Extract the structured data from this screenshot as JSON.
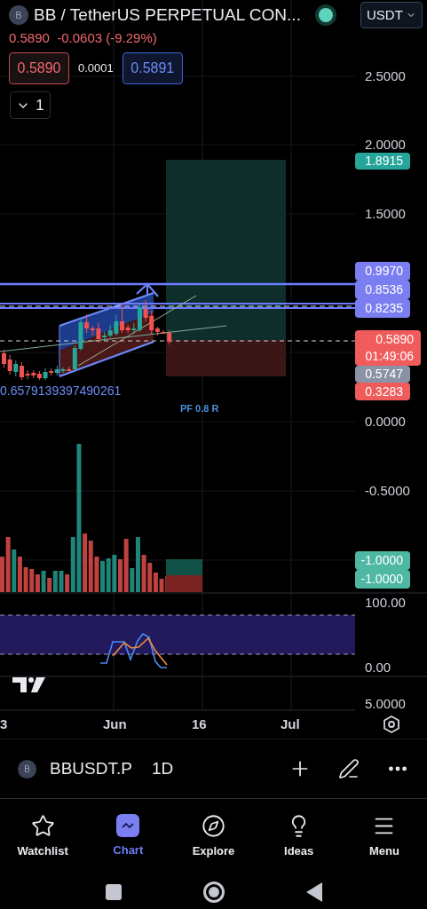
{
  "header": {
    "logo": "B",
    "title": "BB / TetherUS PERPETUAL CON...",
    "live": true,
    "currency": "USDT",
    "last": "0.5890",
    "change": "-0.0603 (-9.29%)",
    "sell": "0.5890",
    "spread": "0.0001",
    "buy": "0.5891",
    "indicators_toggle": "1"
  },
  "price_axis": [
    "2.5000",
    "2.0000",
    "1.5000",
    "0.0000",
    "-0.5000",
    "100.00",
    "0.00",
    "5.0000"
  ],
  "price_badges": [
    {
      "label": "1.8915",
      "color": "#26a69a"
    },
    {
      "label": "0.9970",
      "color": "#7b7ef0"
    },
    {
      "label": "0.8536",
      "color": "#7b7ef0"
    },
    {
      "label": "0.8235",
      "color": "#7b7ef0"
    },
    {
      "label": "0.5890",
      "sub": "01:49:06",
      "color": "#f05b5b"
    },
    {
      "label": "0.5747",
      "color": "#8a93a6"
    },
    {
      "label": "0.3283",
      "color": "#f05b5b"
    },
    {
      "label": "-1.0000",
      "color": "#4fb8a3"
    },
    {
      "label": "-1.0000",
      "color": "#4fb8a3"
    }
  ],
  "chart_labels": [
    "0.6579139397490261",
    "PF 0.8 R"
  ],
  "time_axis": [
    "3",
    "Jun",
    "16",
    "Jul"
  ],
  "symbol_bar": {
    "logo": "B",
    "symbol": "BBUSDT.P",
    "interval": "1D"
  },
  "nav": [
    {
      "label": "Watchlist",
      "selected": false
    },
    {
      "label": "Chart",
      "selected": true
    },
    {
      "label": "Explore",
      "selected": false
    },
    {
      "label": "Ideas",
      "selected": false
    },
    {
      "label": "Menu",
      "selected": false
    }
  ]
}
